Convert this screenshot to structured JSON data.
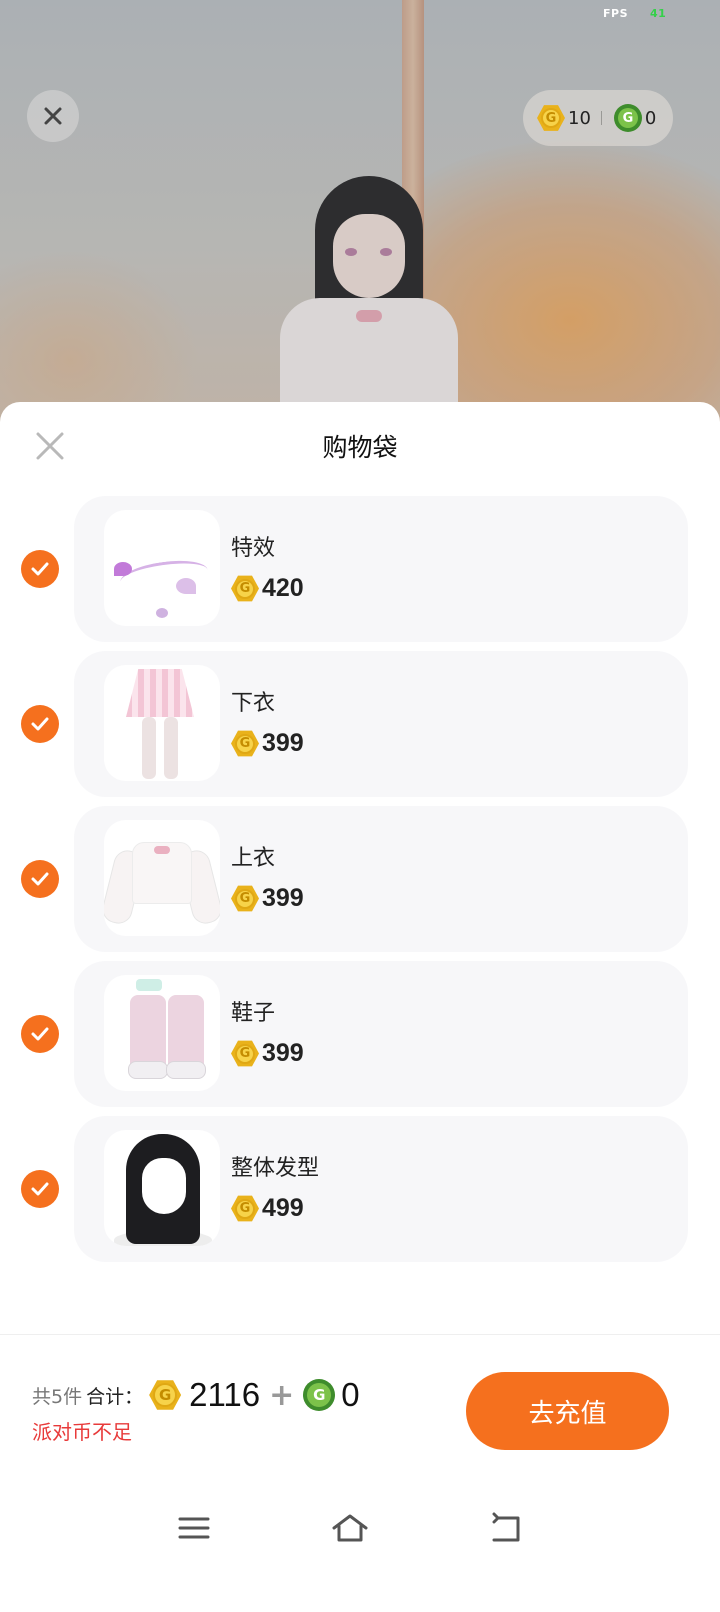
{
  "status": {
    "fps_label": "FPS",
    "fps_value": "41"
  },
  "balance": {
    "gold": "10",
    "green": "0"
  },
  "sheet": {
    "title": "购物袋"
  },
  "items": [
    {
      "name": "特效",
      "price": "420",
      "checked": true,
      "thumb": "effect"
    },
    {
      "name": "下衣",
      "price": "399",
      "checked": true,
      "thumb": "skirt"
    },
    {
      "name": "上衣",
      "price": "399",
      "checked": true,
      "thumb": "top"
    },
    {
      "name": "鞋子",
      "price": "399",
      "checked": true,
      "thumb": "shoes"
    },
    {
      "name": "整体发型",
      "price": "499",
      "checked": true,
      "thumb": "hair"
    }
  ],
  "footer": {
    "count": "共5件",
    "total_label": "合计：",
    "gold_total": "2116",
    "plus": "+",
    "green_total": "0",
    "warning": "派对币不足",
    "recharge_button": "去充值"
  },
  "icons": {
    "gold_coin_letter": "G",
    "green_coin_letter": "G"
  },
  "colors": {
    "accent": "#f5701e",
    "warning": "#e83a3a",
    "gold_coin": "#e9b21b",
    "green_coin": "#3e8c2c",
    "card_bg": "#f7f7f9"
  }
}
